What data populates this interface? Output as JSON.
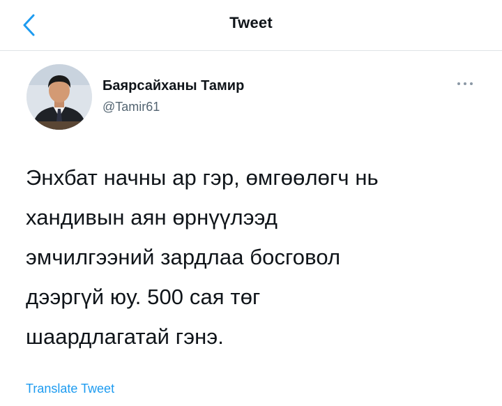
{
  "header": {
    "title": "Tweet"
  },
  "tweet": {
    "author_name": "Баярсайханы Тамир",
    "author_handle": "@Tamir61",
    "lines": [
      "Энхбат начны ар гэр, өмгөөлөгч нь",
      "хандивын аян өрнүүлээд",
      "эмчилгээний зардлаа босговол",
      "дээргүй юу. 500 сая төг",
      "шаардлагатай гэнэ."
    ],
    "translate_label": "Translate Tweet"
  },
  "icons": {
    "back": "chevron-left-icon",
    "more": "more-horizontal-icon"
  },
  "colors": {
    "accent": "#1d9bf0",
    "text": "#0f1419",
    "secondary": "#536471",
    "divider": "#dfe3e6"
  }
}
